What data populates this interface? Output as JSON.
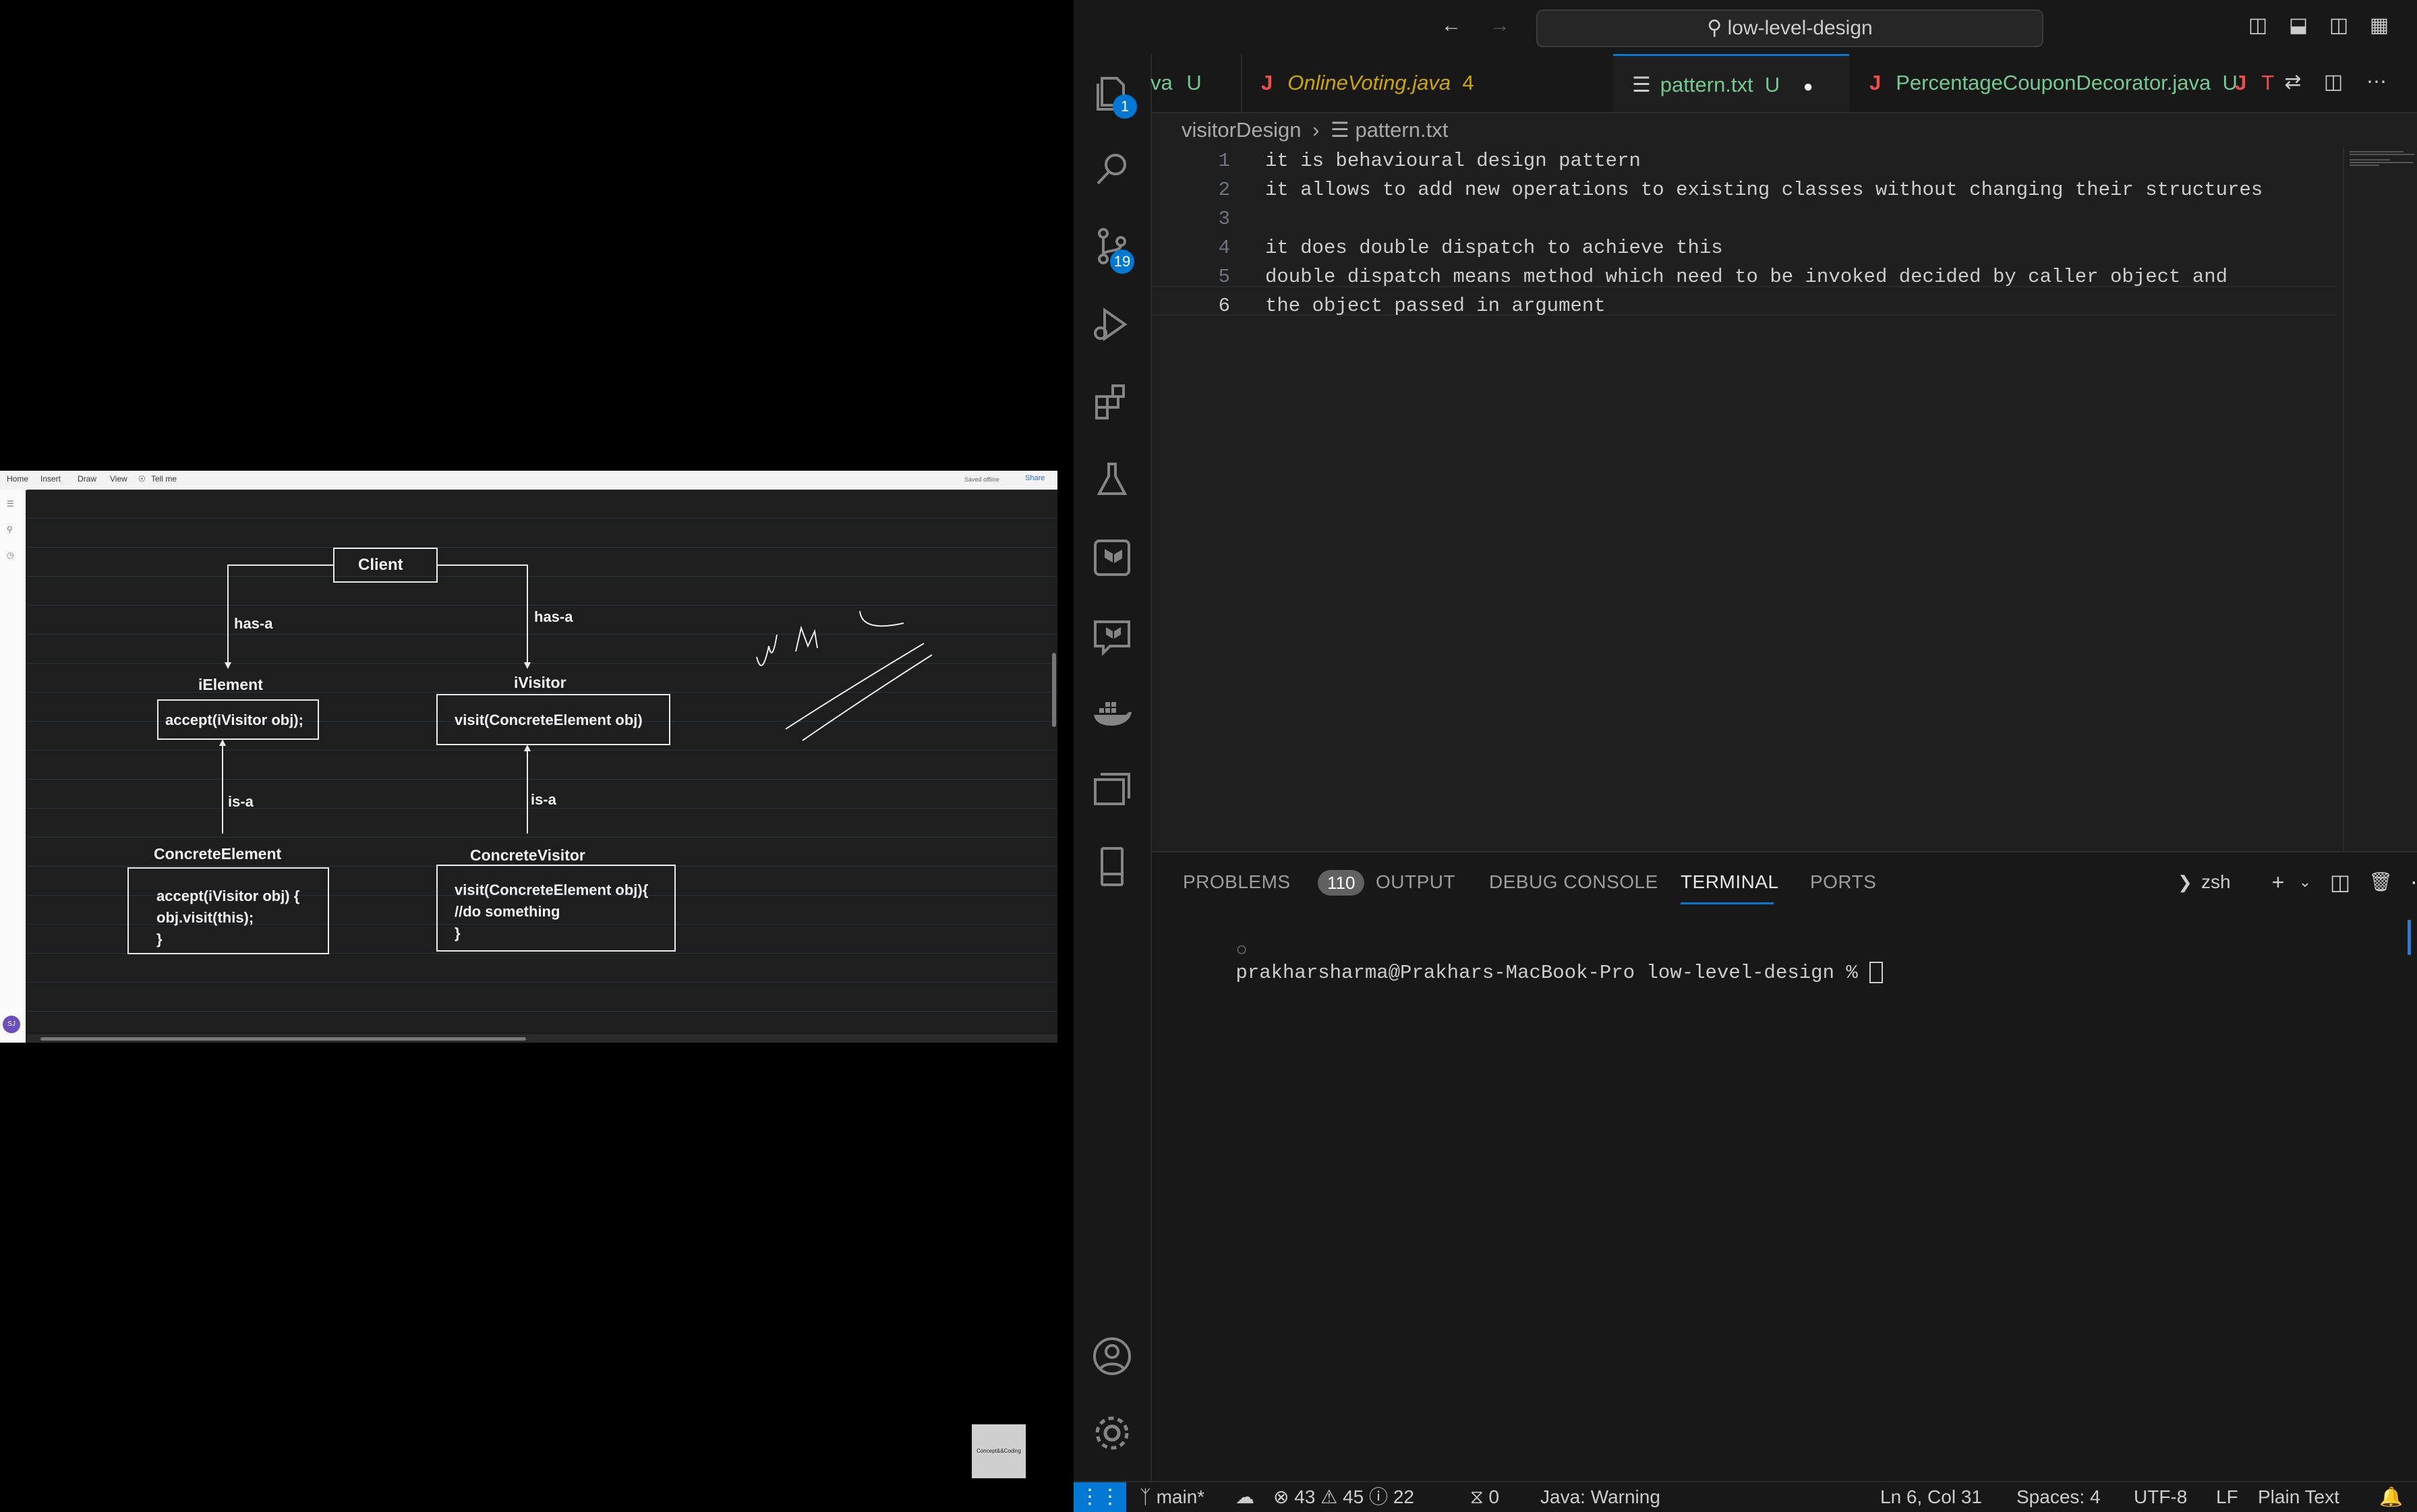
{
  "onenote": {
    "ribbon": {
      "home": "Home",
      "insert": "Insert",
      "draw": "Draw",
      "view": "View",
      "tell_me": "Tell me",
      "saved": "Saved offline",
      "share": "Share"
    },
    "avatar": "SJ",
    "logo_text": "Concept&&Coding"
  },
  "diagram": {
    "client": "Client",
    "has_a_left": "has-a",
    "has_a_right": "has-a",
    "ielement_title": "iElement",
    "ielement_method": "accept(iVisitor obj);",
    "ivisitor_title": "iVisitor",
    "ivisitor_method": "visit(ConcreteElement obj)",
    "is_a_left": "is-a",
    "is_a_right": "is-a",
    "ce_title": "ConcreteElement",
    "ce_line1": "accept(iVisitor obj) {",
    "ce_line2": "obj.visit(this);",
    "ce_line3": "}",
    "cv_title": "ConcreteVisitor",
    "cv_line1": "visit(ConcreteElement obj){",
    "cv_line2": "//do something",
    "cv_line3": "}"
  },
  "vscode": {
    "search": "low-level-design",
    "tabs": [
      {
        "label": "va",
        "status": "U"
      },
      {
        "label": "OnlineVoting.java",
        "status": "4"
      },
      {
        "label": "pattern.txt",
        "status": "U"
      },
      {
        "label": "PercentageCouponDecorator.java",
        "status": "U"
      },
      {
        "label": "T",
        "status": ""
      }
    ],
    "breadcrumb": {
      "folder": "visitorDesign",
      "file": "pattern.txt"
    },
    "editor_lines": [
      {
        "num": "1",
        "text": "it is behavioural design pattern"
      },
      {
        "num": "2",
        "text": "it allows to add new operations to existing classes without changing their structures"
      },
      {
        "num": "3",
        "text": ""
      },
      {
        "num": "4",
        "text": "it does double dispatch to achieve this"
      },
      {
        "num": "5",
        "text": "double dispatch means method which need to be invoked decided by caller object and"
      },
      {
        "num": "6",
        "text": "the object passed in argument"
      }
    ],
    "badges": {
      "explorer": "1",
      "scm": "19"
    },
    "panel": {
      "problems": "PROBLEMS",
      "problems_count": "110",
      "output": "OUTPUT",
      "debug": "DEBUG CONSOLE",
      "terminal": "TERMINAL",
      "ports": "PORTS",
      "shell": "zsh",
      "prompt": "prakharsharma@Prakhars-MacBook-Pro low-level-design % "
    },
    "status": {
      "branch": "main*",
      "errors": "43",
      "warnings": "45",
      "info": "22",
      "ports": "0",
      "java": "Java: Warning",
      "position": "Ln 6, Col 31",
      "spaces": "Spaces: 4",
      "encoding": "UTF-8",
      "eol": "LF",
      "language": "Plain Text"
    },
    "colors": {
      "accent": "#0078d4",
      "background": "#1f1f1f",
      "diagram_bg": "#1e1e1e"
    }
  }
}
